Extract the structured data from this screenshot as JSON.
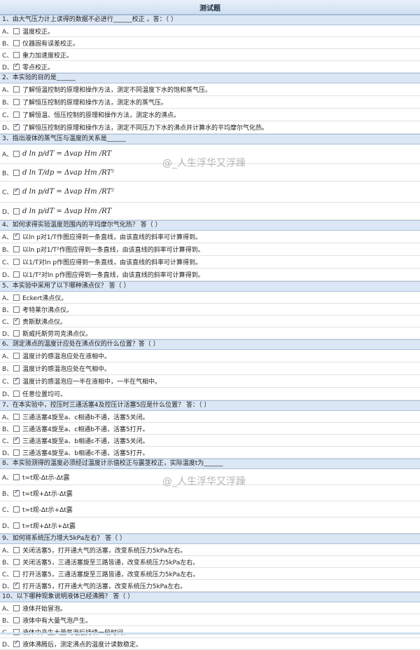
{
  "title": "测试题",
  "watermark": "@_人生浮华又浮躁",
  "questions": [
    {
      "header": "1、由大气压力计上读得的数据不必进行______校正 。答：（ ）",
      "options": [
        {
          "letter": "A、",
          "text": "温度校正。",
          "checked": false
        },
        {
          "letter": "B、",
          "text": "仪器固有误差校正。",
          "checked": false
        },
        {
          "letter": "C、",
          "text": "重力加速度校正。",
          "checked": false
        },
        {
          "letter": "D、",
          "text": "零点校正。",
          "checked": true
        }
      ]
    },
    {
      "header": "2、本实验的目的是______",
      "options": [
        {
          "letter": "A、",
          "text": "了解恒温控制的原理和操作方法，测定不同温度下水的饱和蒸气压。",
          "checked": false
        },
        {
          "letter": "B、",
          "text": "了解恒压控制的原理和操作方法，测定水的蒸气压。",
          "checked": false
        },
        {
          "letter": "C、",
          "text": "了解恒温、恒压控制的原理和操作方法，测定水的沸点。",
          "checked": false
        },
        {
          "letter": "D、",
          "text": "了解恒压控制的原理和操作方法，测定不同压力下水的沸点并计算水的平均摩尔气化热。",
          "checked": true
        }
      ]
    },
    {
      "header": "3、指出液体的蒸气压与温度的关系是______",
      "formula": true,
      "options": [
        {
          "letter": "A、",
          "text": "d ln p/dT = Δvap Hm /RT",
          "checked": false
        },
        {
          "letter": "B、",
          "text": "d ln T/dp = Δvap Hm /RT²",
          "checked": false
        },
        {
          "letter": "C、",
          "text": "d ln p/dT = Δvap Hm /RT²",
          "checked": true
        },
        {
          "letter": "D、",
          "text": "d ln p/dT = Δvap Hm /RT",
          "checked": false
        }
      ]
    },
    {
      "header": "4、如何求得实验温度范围内的平均摩尔气化热？ 答（ ）",
      "options": [
        {
          "letter": "A、",
          "text": "以ln p对1/T作图应得到一条直线，由该直线的斜率可计算得到。",
          "checked": true
        },
        {
          "letter": "B、",
          "text": "以ln p对1/T²作图应得到一条直线，由该直线的斜率可计算得到。",
          "checked": false
        },
        {
          "letter": "C、",
          "text": "以1/T对ln p作图应得到一条直线，由该直线的斜率可计算得到。",
          "checked": false
        },
        {
          "letter": "D、",
          "text": "以1/T²对ln p作图应得到一条直线，由该直线的斜率可计算得到。",
          "checked": false
        }
      ]
    },
    {
      "header": "5、本实验中采用了以下哪种沸点仪？ 答（ ）",
      "options": [
        {
          "letter": "A、",
          "text": "Eckert沸点仪。",
          "checked": false
        },
        {
          "letter": "B、",
          "text": "考特莱尔沸点仪。",
          "checked": false
        },
        {
          "letter": "C、",
          "text": "贵斯默沸点仪。",
          "checked": true
        },
        {
          "letter": "D、",
          "text": "斯威托斯劳司克沸点仪。",
          "checked": false
        }
      ]
    },
    {
      "header": "6、测定沸点的温度计应处在沸点仪的什么位置？答（ ）",
      "options": [
        {
          "letter": "A、",
          "text": "温度计的感温泡应处在液相中。",
          "checked": false
        },
        {
          "letter": "B、",
          "text": "温度计的感温泡应处在气相中。",
          "checked": false
        },
        {
          "letter": "C、",
          "text": "温度计的感温泡应一半在液相中，一半在气相中。",
          "checked": true
        },
        {
          "letter": "D、",
          "text": "任意位置均可。",
          "checked": false
        }
      ]
    },
    {
      "header": "7、在本实验中，控压时三通活塞4及控压计活塞5应是什么位置？ 答：（ ）",
      "options": [
        {
          "letter": "A、",
          "text": "三通活塞4旋至a、c相通b不通，活塞5关闭。",
          "checked": false
        },
        {
          "letter": "B、",
          "text": "三通活塞4旋至a、c相通b不通，活塞5打开。",
          "checked": false
        },
        {
          "letter": "C、",
          "text": "三通活塞4旋至a、b相通c不通，活塞5关闭。",
          "checked": true
        },
        {
          "letter": "D、",
          "text": "三通活塞4旋至a、b相通c不通，活塞5打开。",
          "checked": false
        }
      ]
    },
    {
      "header": "8、本实验测得的温度必须经过温度计示值校正与露茎校正，实际温度t为______",
      "options": [
        {
          "letter": "A、",
          "text": "t=t观-Δt示-Δt露",
          "checked": false
        },
        {
          "letter": "B、",
          "text": "t=t观+Δt示-Δt露",
          "checked": true
        },
        {
          "letter": "C、",
          "text": "t=t观-Δt示+Δt露",
          "checked": false
        },
        {
          "letter": "D、",
          "text": "t=t观+Δt示+Δt露",
          "checked": false
        }
      ]
    },
    {
      "header": "9、如何将系统压力增大5kPa左右？ 答（ ）",
      "options": [
        {
          "letter": "A、",
          "text": "关闭活塞5，打开通大气的活塞，改变系统压力5kPa左右。",
          "checked": false
        },
        {
          "letter": "B、",
          "text": "关闭活塞5，三通活塞旋至三路皆通，改变系统压力5kPa左右。",
          "checked": false
        },
        {
          "letter": "C、",
          "text": "打开活塞5，三通活塞旋至三路皆通，改变系统压力5kPa左右。",
          "checked": false
        },
        {
          "letter": "D、",
          "text": "打开活塞5，打开通大气的活塞，改变系统压力5kPa左右。",
          "checked": true
        }
      ]
    },
    {
      "header": "10、以下哪种现象说明液体已经沸腾？ 答（ ）",
      "options": [
        {
          "letter": "A、",
          "text": "液体开始冒泡。",
          "checked": false
        },
        {
          "letter": "B、",
          "text": "液体中有大量气泡产生。",
          "checked": false
        },
        {
          "letter": "C、",
          "text": "液体中产生大量气泡后持续一段时间。",
          "checked": false
        },
        {
          "letter": "D、",
          "text": "液体沸腾后，测定沸点的温度计读数稳定。",
          "checked": true
        }
      ]
    }
  ]
}
